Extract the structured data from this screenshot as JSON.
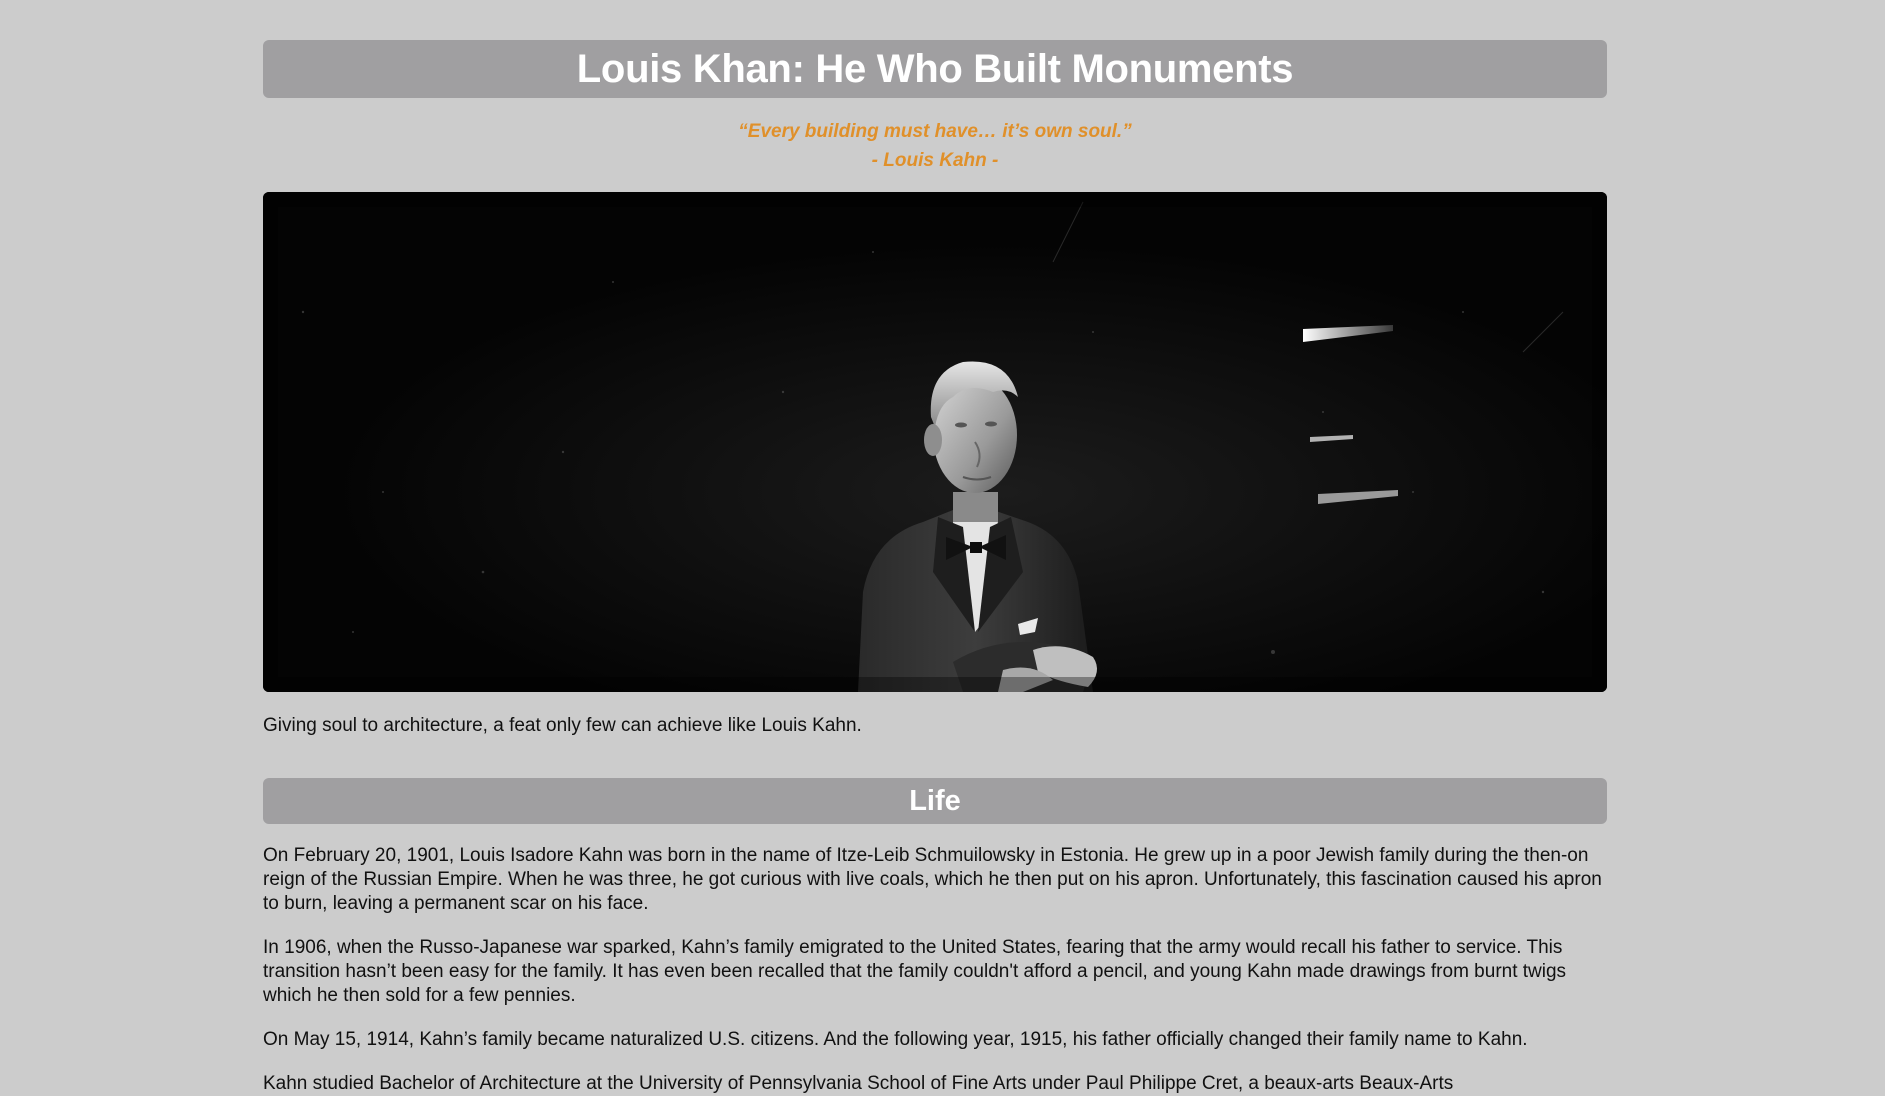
{
  "header": {
    "title": "Louis Khan: He Who Built Monuments"
  },
  "quote": {
    "text": "“Every building must have… it’s own soul.”",
    "author": "- Louis Kahn -"
  },
  "hero_image": {
    "alt": "Black and white photograph of Louis Kahn with arms crossed looking upward"
  },
  "caption": "Giving soul to architecture, a feat only few can achieve like Louis Kahn.",
  "sections": {
    "life": {
      "heading": "Life",
      "paragraphs": [
        "On February 20, 1901, Louis Isadore Kahn was born in the name of Itze-Leib Schmuilowsky in Estonia. He grew up in a poor Jewish family during the then-on reign of the Russian Empire. When he was three, he got curious with live coals, which he then put on his apron. Unfortunately, this fascination caused his apron to burn, leaving a permanent scar on his face.",
        "In 1906, when the Russo-Japanese war sparked, Kahn’s family emigrated to the United States, fearing that the army would recall his father to service. This transition hasn’t been easy for the family. It has even been recalled that the family couldn't afford a pencil, and young Kahn made drawings from burnt twigs which he then sold for a few pennies.",
        "On May 15, 1914, Kahn’s family became naturalized U.S. citizens. And the following year, 1915, his father officially changed their family name to Kahn.",
        "Kahn studied Bachelor of Architecture at the University of Pennsylvania School of Fine Arts under Paul Philippe Cret, a beaux-arts Beaux-Arts"
      ]
    }
  }
}
